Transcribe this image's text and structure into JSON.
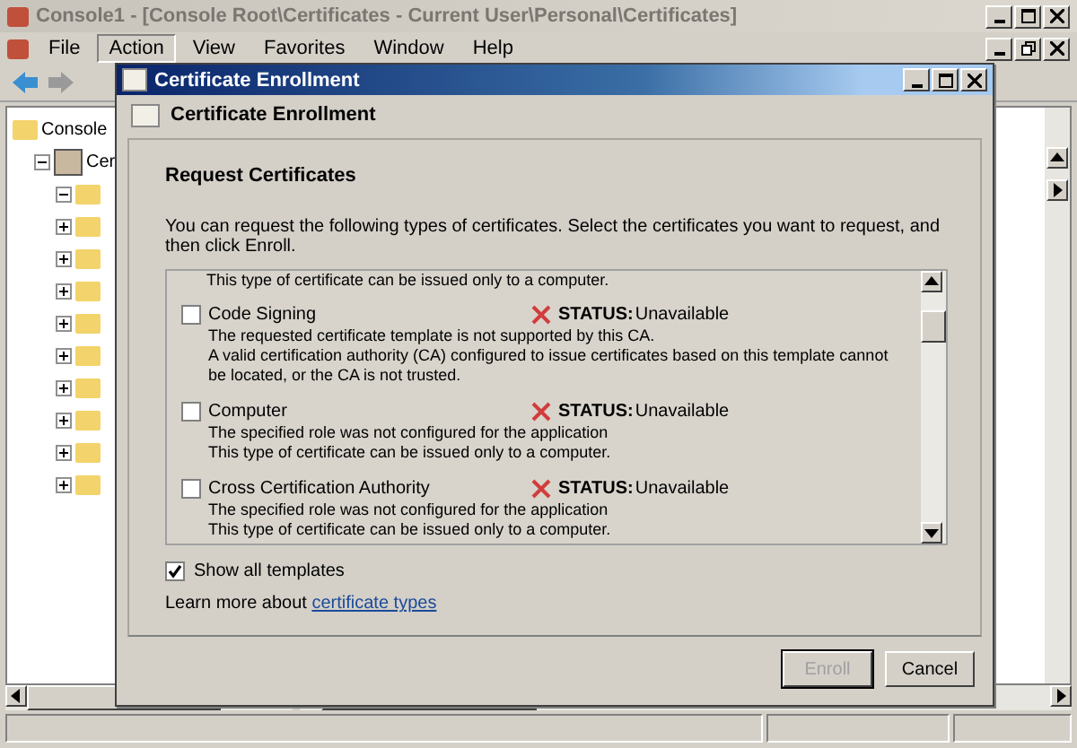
{
  "window": {
    "title": "Console1 - [Console Root\\Certificates - Current User\\Personal\\Certificates]"
  },
  "menu": [
    {
      "label": "File",
      "selected": false
    },
    {
      "label": "Action",
      "selected": true
    },
    {
      "label": "View",
      "selected": false
    },
    {
      "label": "Favorites",
      "selected": false
    },
    {
      "label": "Window",
      "selected": false
    },
    {
      "label": "Help",
      "selected": false
    }
  ],
  "tree": {
    "items": [
      {
        "label": "Console",
        "kind": "folder",
        "children": [
          {
            "label": "Cer",
            "kind": "certificate",
            "expanded": true,
            "children": [
              {
                "kind": "folder",
                "expanded": true
              },
              {
                "kind": "folder",
                "expanded": false
              },
              {
                "kind": "folder",
                "expanded": false
              },
              {
                "kind": "folder",
                "expanded": false
              },
              {
                "kind": "folder",
                "expanded": false
              },
              {
                "kind": "folder",
                "expanded": false
              },
              {
                "kind": "folder",
                "expanded": false
              },
              {
                "kind": "folder",
                "expanded": false
              },
              {
                "kind": "folder",
                "expanded": false
              },
              {
                "kind": "folder",
                "expanded": false
              }
            ]
          }
        ]
      }
    ]
  },
  "dialog": {
    "title": "Certificate Enrollment",
    "header": "Certificate Enrollment",
    "heading": "Request Certificates",
    "intro": "You can request the following types of certificates. Select the certificates you want to request, and then click Enroll.",
    "clipped_line": "This type of certificate can be issued only to a computer.",
    "certificates": [
      {
        "name": "Code Signing",
        "checked": false,
        "status_label": "STATUS:",
        "status": "Unavailable",
        "lines": [
          "The requested certificate template is not supported by this CA.",
          "A valid certification authority (CA) configured to issue certificates based on this template cannot be located, or the CA is not trusted."
        ]
      },
      {
        "name": "Computer",
        "checked": false,
        "status_label": "STATUS:",
        "status": "Unavailable",
        "lines": [
          "The specified role was not configured for the application",
          "This type of certificate can be issued only to a computer."
        ]
      },
      {
        "name": "Cross Certification Authority",
        "checked": false,
        "status_label": "STATUS:",
        "status": "Unavailable",
        "lines": [
          "The specified role was not configured for the application",
          "This type of certificate can be issued only to a computer."
        ]
      }
    ],
    "show_all": {
      "label": "Show all templates",
      "checked": true
    },
    "learn_more": {
      "text": "Learn more about",
      "link": "certificate types"
    },
    "buttons": [
      {
        "label": "Enroll",
        "disabled": true
      },
      {
        "label": "Cancel",
        "disabled": false
      }
    ]
  }
}
